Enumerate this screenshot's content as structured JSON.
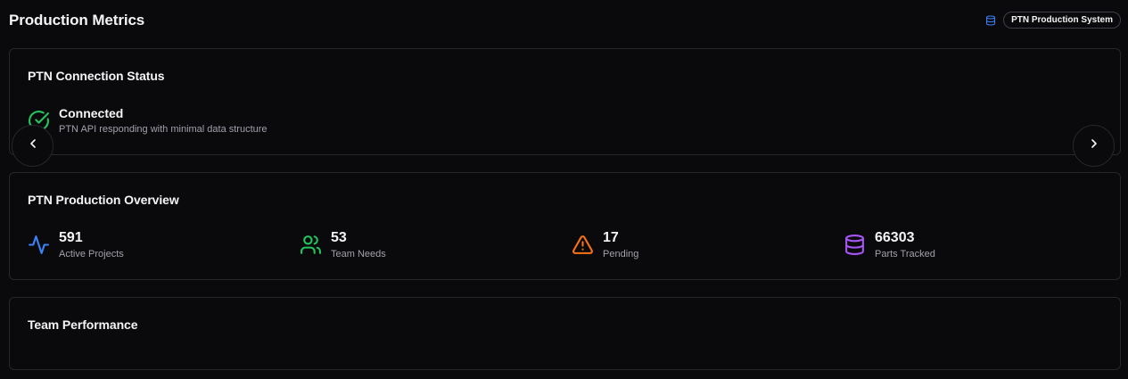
{
  "header": {
    "title": "Production Metrics",
    "system_badge": "PTN Production System",
    "system_icon": "database-icon"
  },
  "connection": {
    "title": "PTN Connection Status",
    "status": "Connected",
    "message": "PTN API responding with minimal data structure",
    "status_icon": "check-circle-icon",
    "status_color": "#22c55e"
  },
  "carousel": {
    "prev_icon": "chevron-left-icon",
    "next_icon": "chevron-right-icon"
  },
  "overview": {
    "title": "PTN Production Overview",
    "metrics": [
      {
        "value": "591",
        "label": "Active Projects",
        "icon": "activity-icon",
        "color": "#3b82f6"
      },
      {
        "value": "53",
        "label": "Team Needs",
        "icon": "users-icon",
        "color": "#22c55e"
      },
      {
        "value": "17",
        "label": "Pending",
        "icon": "alert-triangle-icon",
        "color": "#f97316"
      },
      {
        "value": "66303",
        "label": "Parts Tracked",
        "icon": "database-icon",
        "color": "#a855f7"
      }
    ]
  },
  "team": {
    "title": "Team Performance"
  }
}
